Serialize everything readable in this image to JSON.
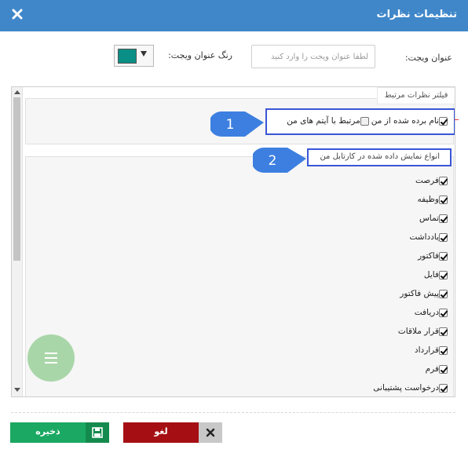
{
  "window": {
    "title": "تنظیمات نظرات"
  },
  "form": {
    "widget_title_label": "عنوان ویجت:",
    "widget_title_placeholder": "لطفا عنوان ویجت را وارد کنید",
    "widget_title_value": "",
    "title_color_label": "رنگ عنوان ویجت:",
    "title_color_value": "#0a8f86"
  },
  "filter": {
    "legend": "فیلتر نظرات مرتبط",
    "mentioned_label": "نام برده شده از من",
    "mentioned_checked": true,
    "related_label": "مرتبط با آیتم های من",
    "related_checked": false
  },
  "types": {
    "legend": "انواع نمایش داده شده در کارتابل من",
    "items": [
      {
        "label": "فرصت",
        "checked": true
      },
      {
        "label": "وظیفه",
        "checked": true
      },
      {
        "label": "تماس",
        "checked": true
      },
      {
        "label": "یادداشت",
        "checked": true
      },
      {
        "label": "فاکتور",
        "checked": true
      },
      {
        "label": "فایل",
        "checked": true
      },
      {
        "label": "پیش فاکتور",
        "checked": true
      },
      {
        "label": "دریافت",
        "checked": true
      },
      {
        "label": "قرار ملاقات",
        "checked": true
      },
      {
        "label": "قرارداد",
        "checked": true
      },
      {
        "label": "فرم",
        "checked": true
      },
      {
        "label": "درخواست پشتیبانی",
        "checked": true
      }
    ]
  },
  "callouts": {
    "first": "1",
    "second": "2"
  },
  "buttons": {
    "save": "ذخیره",
    "cancel": "لغو"
  },
  "colors": {
    "header": "#3f87c9",
    "save": "#1ba862",
    "cancel": "#a50f13",
    "highlight": "#3a56d6",
    "callout": "#3d7fe0"
  },
  "icons": [
    "close-icon",
    "menu-icon",
    "save-icon",
    "cancel-x-icon",
    "caret-down-icon"
  ]
}
